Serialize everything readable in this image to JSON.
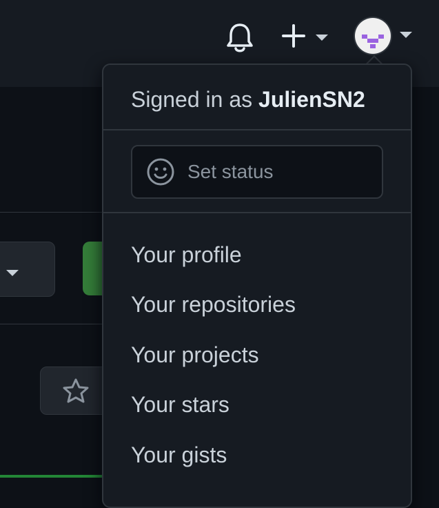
{
  "header": {
    "icons": {
      "notifications": "bell-icon",
      "create": "plus-icon",
      "create_caret": "caret-down-icon",
      "avatar_caret": "caret-down-icon"
    }
  },
  "background": {
    "star_icon": "star-icon"
  },
  "user_menu": {
    "signed_in_prefix": "Signed in as ",
    "username": "JulienSN2",
    "set_status": {
      "icon": "smiley-icon",
      "label": "Set status"
    },
    "items": [
      {
        "label": "Your profile"
      },
      {
        "label": "Your repositories"
      },
      {
        "label": "Your projects"
      },
      {
        "label": "Your stars"
      },
      {
        "label": "Your gists"
      }
    ]
  },
  "colors": {
    "header_bg": "#161b22",
    "page_bg": "#0d1117",
    "border": "#30363d",
    "text": "#c9d1d9",
    "muted": "#8b949e",
    "green": "#347d39",
    "avatar_accent": "#9a63e0"
  }
}
